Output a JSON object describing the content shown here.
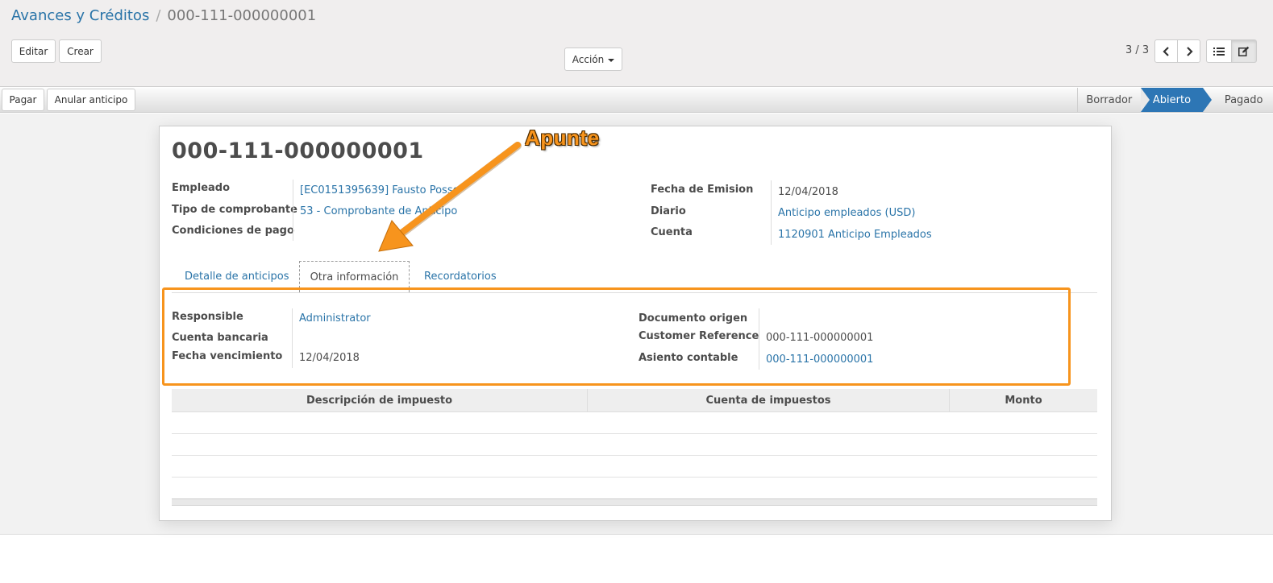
{
  "breadcrumb": {
    "parent": "Avances y Créditos",
    "separator": "/",
    "current": "000-111-000000001"
  },
  "toolbar": {
    "edit_label": "Editar",
    "create_label": "Crear",
    "action_label": "Acción",
    "pager": "3 / 3",
    "icons": {
      "prev": "chevron-left-icon",
      "next": "chevron-right-icon",
      "list_view": "list-icon",
      "form_view": "edit-icon"
    }
  },
  "statusbar": {
    "buttons": [
      "Pagar",
      "Anular anticipo"
    ],
    "steps": [
      "Borrador",
      "Abierto",
      "Pagado"
    ],
    "active_step": "Abierto",
    "active_color": "#2d76b5"
  },
  "form": {
    "title": "000-111-000000001",
    "left_fields": [
      {
        "label": "Empleado",
        "value": "[EC0151395639] Fausto Posso"
      },
      {
        "label": "Tipo de comprobante",
        "value": "53 - Comprobante de Anticipo"
      },
      {
        "label": "Condiciones de pago",
        "value": ""
      }
    ],
    "right_fields": [
      {
        "label": "Fecha de Emision",
        "value": "12/04/2018"
      },
      {
        "label": "Diario",
        "value": "Anticipo empleados (USD)"
      },
      {
        "label": "Cuenta",
        "value": "1120901 Anticipo Empleados"
      }
    ]
  },
  "tabs": [
    {
      "label": "Detalle de anticipos",
      "active": false
    },
    {
      "label": "Otra información",
      "active": true
    },
    {
      "label": "Recordatorios",
      "active": false
    }
  ],
  "other_info": {
    "left_fields": [
      {
        "label": "Responsible",
        "value": "Administrator"
      },
      {
        "label": "Cuenta bancaria",
        "value": ""
      },
      {
        "label": "Fecha vencimiento",
        "value": "12/04/2018"
      }
    ],
    "right_fields": [
      {
        "label": "Documento origen",
        "value": ""
      },
      {
        "label": "Customer Reference",
        "value": "000-111-000000001"
      },
      {
        "label": "Asiento contable",
        "value": "000-111-000000001"
      }
    ]
  },
  "tax_table": {
    "columns": [
      "Descripción de impuesto",
      "Cuenta de impuestos",
      "Monto"
    ],
    "rows": []
  },
  "annotation": {
    "text": "Apunte",
    "color": "#f7941d"
  }
}
